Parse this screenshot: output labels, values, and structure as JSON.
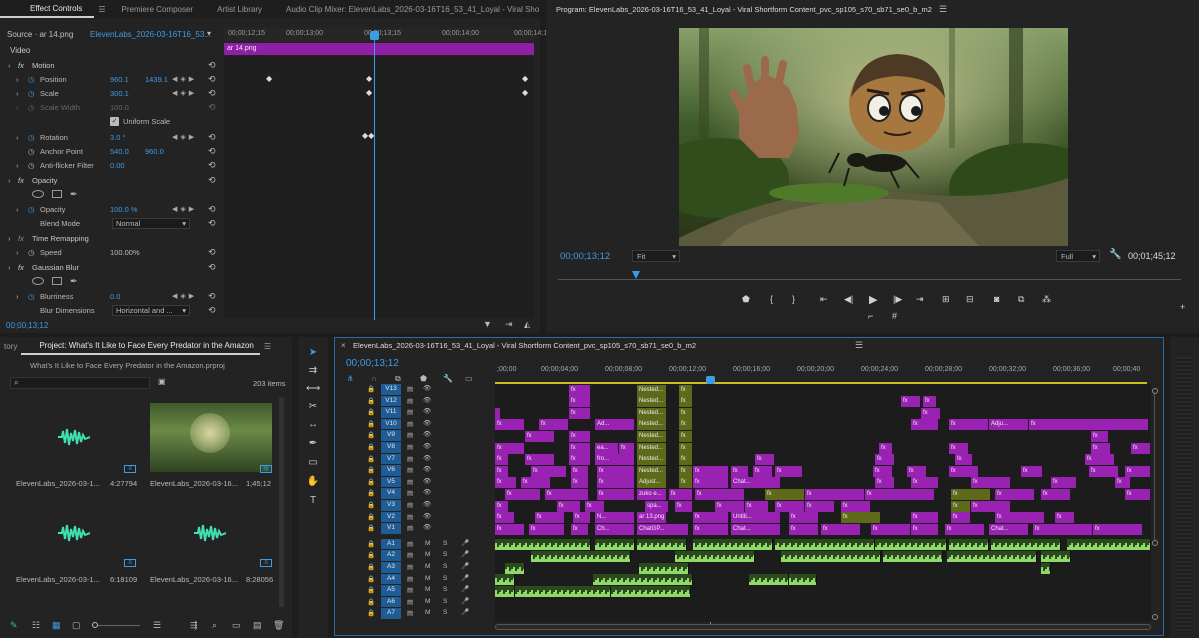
{
  "effect_controls": {
    "tabs": [
      "Effect Controls",
      "Premiere Composer",
      "Artist Library",
      "Audio Clip Mixer: ElevenLabs_2026-03-16T16_53_41_Loyal - Viral Sho"
    ],
    "source_label": "Source · ar 14.png",
    "sequence_label": "ElevenLabs_2026-03-16T16_53...",
    "section_video": "Video",
    "ruler": [
      "00;00;12;15",
      "00;00;13;00",
      "00;00;13;15",
      "00;00;14;00",
      "00;00;14;1"
    ],
    "clip_name": "ar 14.png",
    "motion": "Motion",
    "position_label": "Position",
    "position_x": "960.1",
    "position_y": "1439.1",
    "scale_label": "Scale",
    "scale_val": "300.1",
    "scale_width_label": "Scale Width",
    "scale_width_val": "100.0",
    "uniform_label": "Uniform Scale",
    "rotation_label": "Rotation",
    "rotation_val": "3.0 °",
    "anchor_label": "Anchor Point",
    "anchor_x": "540.0",
    "anchor_y": "960.0",
    "antiflicker_label": "Anti-flicker Filter",
    "antiflicker_val": "0.00",
    "opacity_section": "Opacity",
    "opacity_label": "Opacity",
    "opacity_val": "100.0 %",
    "blend_label": "Blend Mode",
    "blend_val": "Normal",
    "time_remap": "Time Remapping",
    "speed_label": "Speed",
    "speed_val": "100.00%",
    "blur_section": "Gaussian Blur",
    "blurriness_label": "Blurriness",
    "blurriness_val": "0.0",
    "blurdim_label": "Blur Dimensions",
    "blurdim_val": "Horizontal and ...",
    "timecode": "00;00;13;12"
  },
  "program": {
    "title": "Program: ElevenLabs_2026-03-16T16_53_41_Loyal - Viral Shortform Content_pvc_sp105_s70_sb71_se0_b_m2",
    "timecode": "00;00;13;12",
    "fit": "Fit",
    "quality": "Full",
    "duration": "00;01;45;12"
  },
  "project": {
    "tabs": [
      "tory",
      "Project: What's It Like to Face Every Predator in the Amazon"
    ],
    "file": "What's It Like to Face Every Predator in the Amazon.prproj",
    "items_count": "203 items",
    "items": [
      {
        "name": "ElevenLabs_2026-03-1...",
        "dur": "4:27794",
        "kind": "audio"
      },
      {
        "name": "ElevenLabs_2026-03-16...",
        "dur": "1;45;12",
        "kind": "video"
      },
      {
        "name": "ElevenLabs_2026-03-1...",
        "dur": "6:18109",
        "kind": "audio"
      },
      {
        "name": "ElevenLabs_2026-03-16...",
        "dur": "8:28056",
        "kind": "audio"
      }
    ]
  },
  "timeline": {
    "title": "ElevenLabs_2026-03-16T16_53_41_Loyal - Viral Shortform Content_pvc_sp105_s70_sb71_se0_b_m2",
    "timecode": "00;00;13;12",
    "ruler": [
      ";00;00",
      "00;00;04;00",
      "00;00;08;00",
      "00;00;12;00",
      "00;00;16;00",
      "00;00;20;00",
      "00;00;24;00",
      "00;00;28;00",
      "00;00;32;00",
      "00;00;36;00",
      "00;00;40"
    ],
    "video_tracks": [
      "V13",
      "V12",
      "V11",
      "V10",
      "V9",
      "V8",
      "V7",
      "V6",
      "V5",
      "V4",
      "V3",
      "V2",
      "V1"
    ],
    "audio_tracks": [
      "A1",
      "A2",
      "A3",
      "A4",
      "A5",
      "A6",
      "A7"
    ],
    "clip_labels": {
      "nested": "Nested...",
      "adjust": "Adjust...",
      "chat": "Chat...",
      "chatgp": "ChatGP...",
      "untitled": "Untiti...",
      "zuko": "zuko e...",
      "spa": "spa...",
      "ar13": "ar 13.png",
      "fro": "fro...",
      "ea": "ea...",
      "ad": "Ad...",
      "adju": "Adju...",
      "n": "N...",
      "ch": "Ch...",
      "fx": "fx"
    }
  }
}
